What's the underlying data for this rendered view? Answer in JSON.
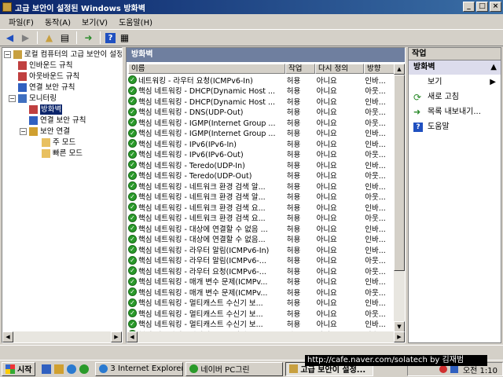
{
  "window": {
    "title": "고급 보안이 설정된 Windows 방화벽"
  },
  "menu": [
    "파일(F)",
    "동작(A)",
    "보기(V)",
    "도움말(H)"
  ],
  "tree": {
    "root": "로컬 컴퓨터의 고급 보안이 설정",
    "inbound": "인바운드 규칙",
    "outbound": "아웃바운드 규칙",
    "connsec": "연결 보안 규칙",
    "monitoring": "모니터링",
    "firewall": "방화벽",
    "mon_connsec": "연결 보안 규칙",
    "sa": "보안 연결",
    "main_mode": "주 모드",
    "quick_mode": "빠른 모드"
  },
  "center": {
    "title": "방화벽",
    "columns": [
      "이름",
      "작업",
      "다시 정의",
      "방향"
    ]
  },
  "rules": [
    {
      "name": "네트워킹 - 라우터 요청(ICMPv6-In)",
      "action": "허용",
      "override": "아니요",
      "dir": "인바..."
    },
    {
      "name": "핵심 네트워킹 - DHCP(Dynamic Host ...",
      "action": "허용",
      "override": "아니요",
      "dir": "아웃..."
    },
    {
      "name": "핵심 네트워킹 - DHCP(Dynamic Host ...",
      "action": "허용",
      "override": "아니요",
      "dir": "인바..."
    },
    {
      "name": "핵심 네트워킹 - DNS(UDP-Out)",
      "action": "허용",
      "override": "아니요",
      "dir": "아웃..."
    },
    {
      "name": "핵심 네트워킹 - IGMP(Internet Group ...",
      "action": "허용",
      "override": "아니요",
      "dir": "아웃..."
    },
    {
      "name": "핵심 네트워킹 - IGMP(Internet Group ...",
      "action": "허용",
      "override": "아니요",
      "dir": "인바..."
    },
    {
      "name": "핵심 네트워킹 - IPv6(IPv6-In)",
      "action": "허용",
      "override": "아니요",
      "dir": "인바..."
    },
    {
      "name": "핵심 네트워킹 - IPv6(IPv6-Out)",
      "action": "허용",
      "override": "아니요",
      "dir": "아웃..."
    },
    {
      "name": "핵심 네트워킹 - Teredo(UDP-In)",
      "action": "허용",
      "override": "아니요",
      "dir": "인바..."
    },
    {
      "name": "핵심 네트워킹 - Teredo(UDP-Out)",
      "action": "허용",
      "override": "아니요",
      "dir": "아웃..."
    },
    {
      "name": "핵심 네트워킹 - 네트워크 환경 검색 알...",
      "action": "허용",
      "override": "아니요",
      "dir": "인바..."
    },
    {
      "name": "핵심 네트워킹 - 네트워크 환경 검색 알...",
      "action": "허용",
      "override": "아니요",
      "dir": "아웃..."
    },
    {
      "name": "핵심 네트워킹 - 네트워크 환경 검색 요...",
      "action": "허용",
      "override": "아니요",
      "dir": "인바..."
    },
    {
      "name": "핵심 네트워킹 - 네트워크 환경 검색 요...",
      "action": "허용",
      "override": "아니요",
      "dir": "아웃..."
    },
    {
      "name": "핵심 네트워킹 - 대상에 연결할 수 없음 ...",
      "action": "허용",
      "override": "아니요",
      "dir": "인바..."
    },
    {
      "name": "핵심 네트워킹 - 대상에 연결할 수 없음...",
      "action": "허용",
      "override": "아니요",
      "dir": "인바..."
    },
    {
      "name": "핵심 네트워킹 - 라우터 알림(ICMPv6-In)",
      "action": "허용",
      "override": "아니요",
      "dir": "인바..."
    },
    {
      "name": "핵심 네트워킹 - 라우터 알림(ICMPv6-...",
      "action": "허용",
      "override": "아니요",
      "dir": "아웃..."
    },
    {
      "name": "핵심 네트워킹 - 라우터 요청(ICMPv6-...",
      "action": "허용",
      "override": "아니요",
      "dir": "아웃..."
    },
    {
      "name": "핵심 네트워킹 - 매개 변수 문제(ICMPv...",
      "action": "허용",
      "override": "아니요",
      "dir": "인바..."
    },
    {
      "name": "핵심 네트워킹 - 매개 변수 문제(ICMPv...",
      "action": "허용",
      "override": "아니요",
      "dir": "아웃..."
    },
    {
      "name": "핵심 네트워킹 - 멀티캐스트 수신기 보...",
      "action": "허용",
      "override": "아니요",
      "dir": "인바..."
    },
    {
      "name": "핵심 네트워킹 - 멀티캐스트 수신기 보...",
      "action": "허용",
      "override": "아니요",
      "dir": "아웃..."
    },
    {
      "name": "핵심 네트워킹 - 멀티캐스트 수신기 보...",
      "action": "허용",
      "override": "아니요",
      "dir": "인바..."
    },
    {
      "name": "핵심 네트워킹 - 멀티캐스트 수신기 보...",
      "action": "허용",
      "override": "아니요",
      "dir": "아웃..."
    }
  ],
  "actions": {
    "title": "작업",
    "group": "방화벽",
    "view": "보기",
    "refresh": "새로 고침",
    "export": "목록 내보내기...",
    "help": "도움말"
  },
  "taskbar": {
    "start": "시작",
    "ie": "3 Internet Explorer",
    "naver": "네이버 PC그린",
    "active": "고급 보안이 설정...",
    "clock": "오전 1:10"
  },
  "watermark": "http://cafe.naver.com/solatech by 김재범"
}
